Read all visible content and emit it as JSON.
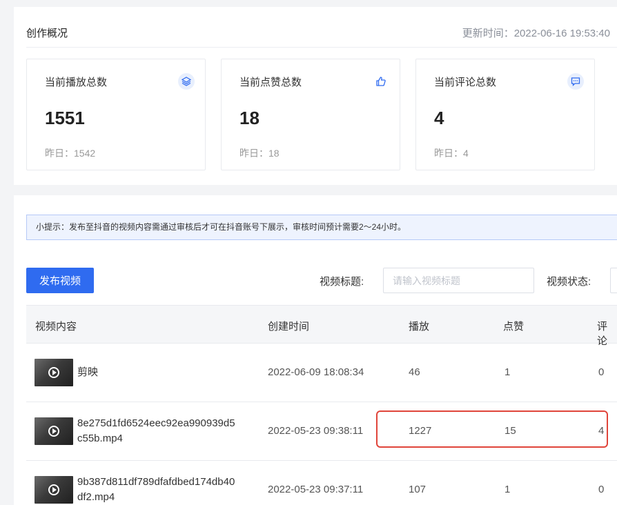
{
  "overview": {
    "title": "创作概况",
    "update_time": "更新时间：2022-06-16 19:53:40"
  },
  "stats": [
    {
      "label": "当前播放总数",
      "value": "1551",
      "yesterday": "昨日：1542",
      "icon": "layers-icon"
    },
    {
      "label": "当前点赞总数",
      "value": "18",
      "yesterday": "昨日：18",
      "icon": "thumbs-up-icon"
    },
    {
      "label": "当前评论总数",
      "value": "4",
      "yesterday": "昨日：4",
      "icon": "comment-icon"
    }
  ],
  "tip": "小提示：发布至抖音的视频内容需通过审核后才可在抖音账号下展示，审核时间预计需要2～24小时。",
  "toolbar": {
    "publish_label": "发布视频",
    "title_filter_label": "视频标题:",
    "title_placeholder": "请输入视频标题",
    "status_filter_label": "视频状态:"
  },
  "table": {
    "headers": [
      "视频内容",
      "创建时间",
      "播放",
      "点赞",
      "评论"
    ],
    "rows": [
      {
        "name_line1": "剪映",
        "name_line2": "",
        "created": "2022-06-09 18:08:34",
        "plays": "46",
        "likes": "1",
        "comments": "0"
      },
      {
        "name_line1": "8e275d1fd6524eec92ea990939d5",
        "name_line2": "c55b.mp4",
        "created": "2022-05-23 09:38:11",
        "plays": "1227",
        "likes": "15",
        "comments": "4"
      },
      {
        "name_line1": "9b387d811df789dfafdbed174db40",
        "name_line2": "df2.mp4",
        "created": "2022-05-23 09:37:11",
        "plays": "107",
        "likes": "1",
        "comments": "0"
      }
    ]
  },
  "colors": {
    "accent": "#2f6bf0",
    "highlight": "#e0443a",
    "tip_bg": "#eef3fe"
  }
}
